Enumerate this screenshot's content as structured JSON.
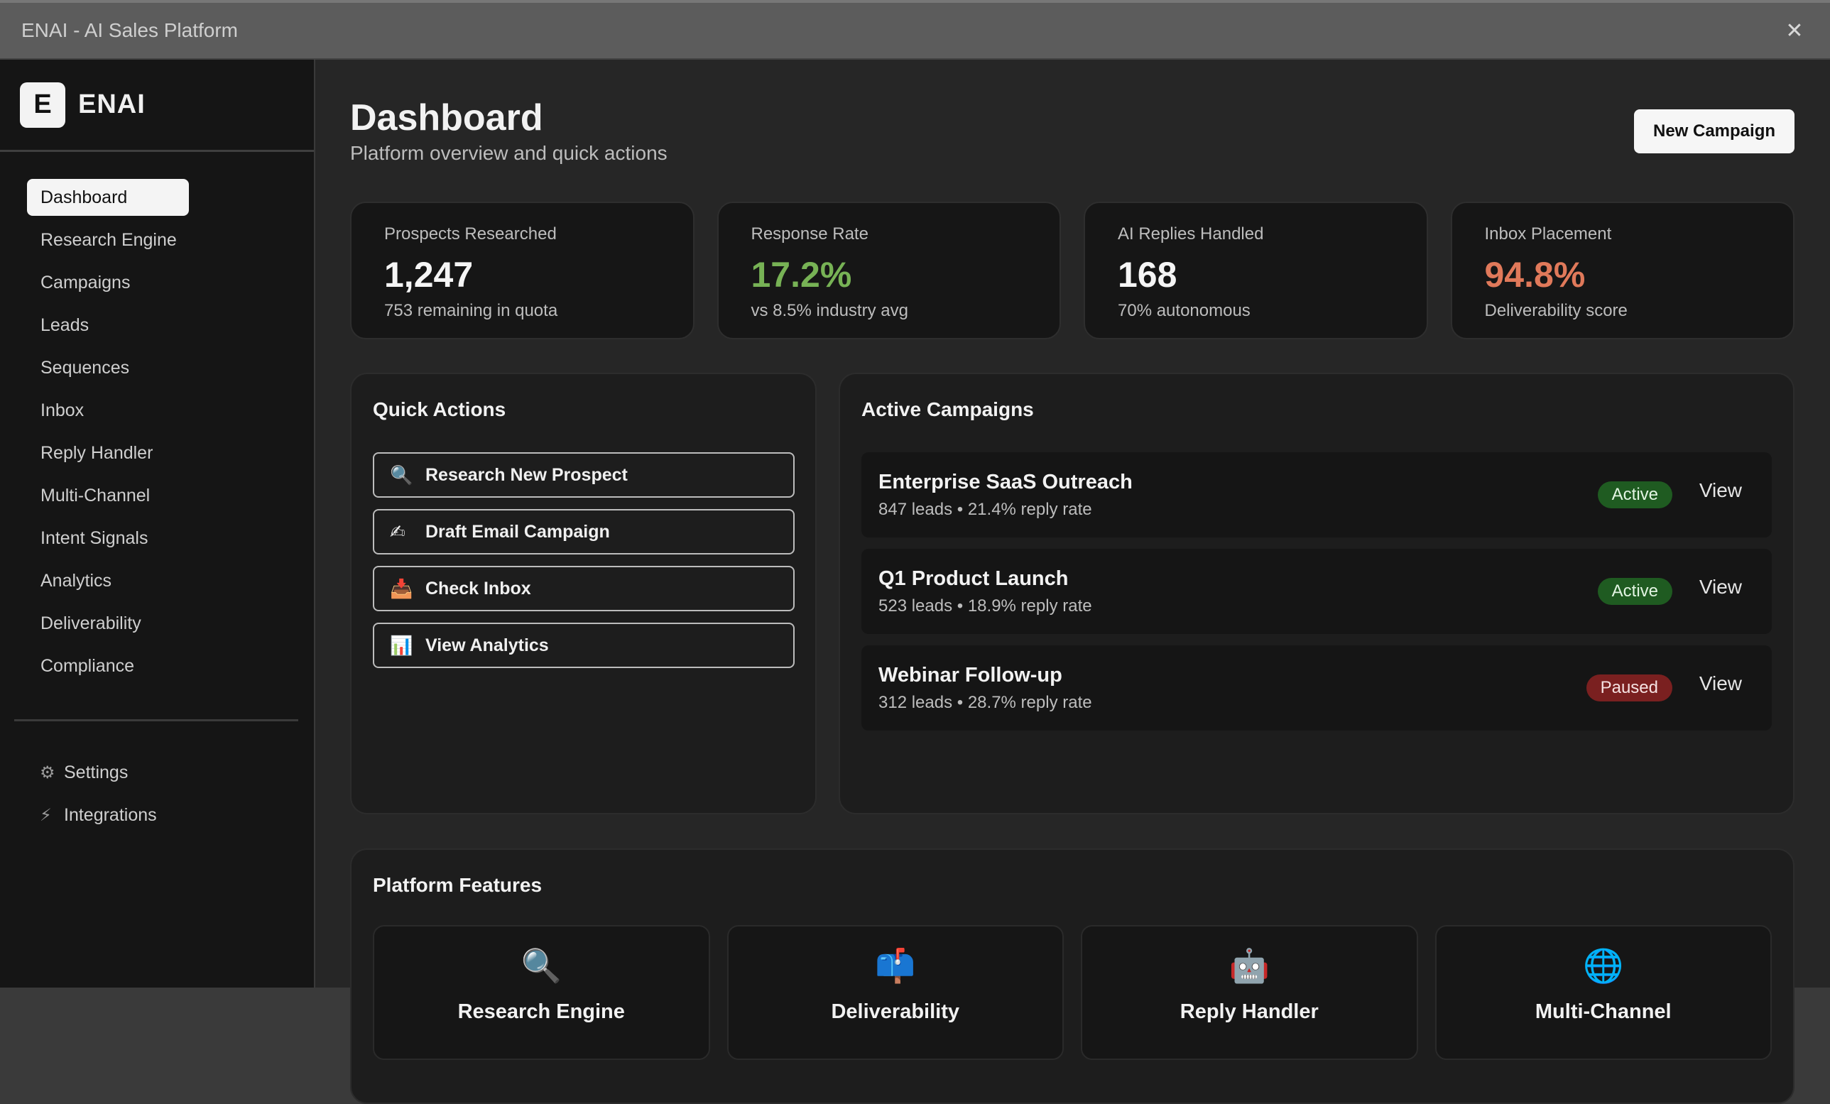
{
  "window": {
    "title": "ENAI - AI Sales Platform",
    "close_glyph": "✕"
  },
  "brand": {
    "logo_letter": "E",
    "name": "ENAI"
  },
  "sidebar": {
    "items": [
      {
        "label": "Dashboard",
        "active": true
      },
      {
        "label": "Research Engine"
      },
      {
        "label": "Campaigns"
      },
      {
        "label": "Leads"
      },
      {
        "label": "Sequences"
      },
      {
        "label": "Inbox"
      },
      {
        "label": "Reply Handler"
      },
      {
        "label": "Multi-Channel"
      },
      {
        "label": "Intent Signals"
      },
      {
        "label": "Analytics"
      },
      {
        "label": "Deliverability"
      },
      {
        "label": "Compliance"
      }
    ],
    "bottom": [
      {
        "label": "Settings",
        "icon": "gear-icon",
        "glyph": "⚙"
      },
      {
        "label": "Integrations",
        "icon": "plug-icon",
        "glyph": "⚡"
      }
    ]
  },
  "header": {
    "title": "Dashboard",
    "subtitle": "Platform overview and quick actions",
    "new_campaign_label": "New Campaign"
  },
  "stats": [
    {
      "label": "Prospects Researched",
      "value": "1,247",
      "note": "753 remaining in quota",
      "color": "#f5f5f5"
    },
    {
      "label": "Response Rate",
      "value": "17.2%",
      "note": "vs 8.5% industry avg",
      "color": "#77b255"
    },
    {
      "label": "AI Replies Handled",
      "value": "168",
      "note": "70% autonomous",
      "color": "#f5f5f5"
    },
    {
      "label": "Inbox Placement",
      "value": "94.8%",
      "note": "Deliverability score",
      "color": "#e0795a"
    }
  ],
  "quick_actions": {
    "title": "Quick Actions",
    "items": [
      {
        "label": "Research New Prospect",
        "icon": "magnifier-icon",
        "glyph": "🔍"
      },
      {
        "label": "Draft Email Campaign",
        "icon": "writing-hand-icon",
        "glyph": "✍"
      },
      {
        "label": "Check Inbox",
        "icon": "inbox-tray-icon",
        "glyph": "📥"
      },
      {
        "label": "View Analytics",
        "icon": "bar-chart-icon",
        "glyph": "📊"
      }
    ]
  },
  "active_campaigns": {
    "title": "Active Campaigns",
    "items": [
      {
        "name": "Enterprise SaaS Outreach",
        "meta": "847 leads • 21.4% reply rate",
        "status": "Active",
        "view": "View"
      },
      {
        "name": "Q1 Product Launch",
        "meta": "523 leads • 18.9% reply rate",
        "status": "Active",
        "view": "View"
      },
      {
        "name": "Webinar Follow-up",
        "meta": "312 leads • 28.7% reply rate",
        "status": "Paused",
        "view": "View"
      }
    ]
  },
  "platform_features": {
    "title": "Platform Features",
    "items": [
      {
        "name": "Research Engine",
        "icon": "magnifier-icon",
        "glyph": "🔍"
      },
      {
        "name": "Deliverability",
        "icon": "mailbox-icon",
        "glyph": "📫"
      },
      {
        "name": "Reply Handler",
        "icon": "robot-icon",
        "glyph": "🤖"
      },
      {
        "name": "Multi-Channel",
        "icon": "globe-icon",
        "glyph": "🌐"
      }
    ]
  }
}
